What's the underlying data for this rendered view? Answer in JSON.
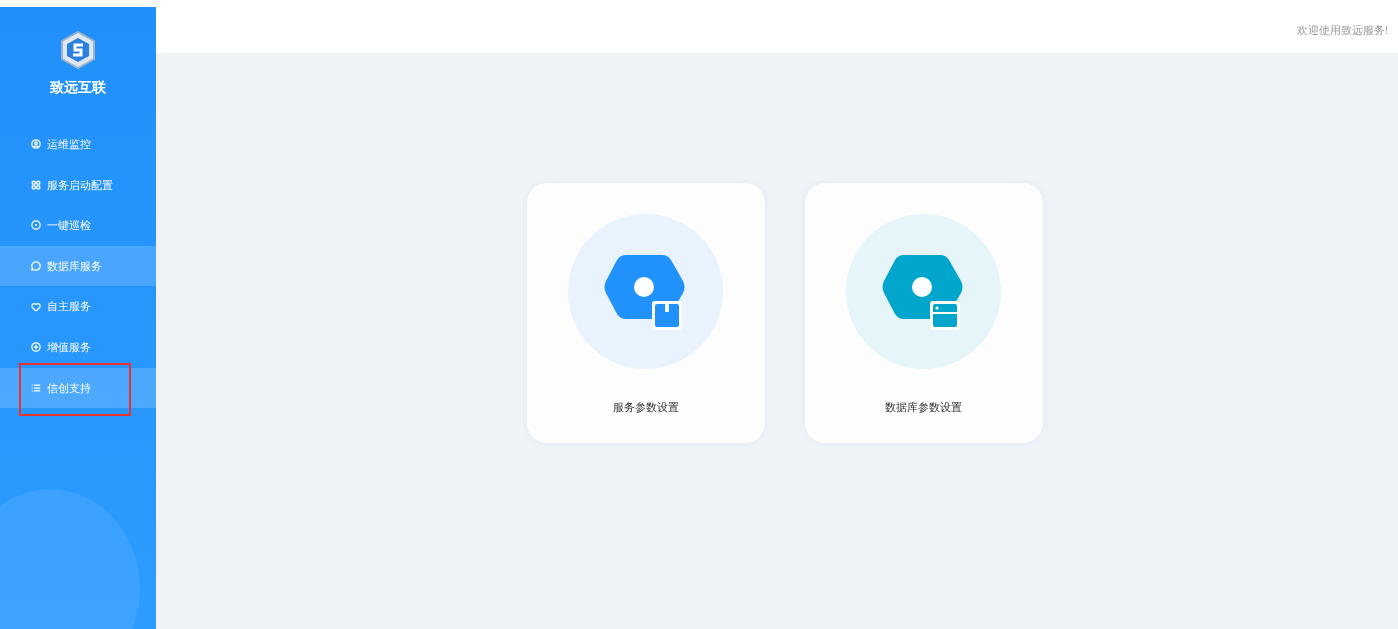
{
  "brand": {
    "name": "致远互联"
  },
  "sidebar": {
    "items": [
      {
        "label": "运维监控",
        "kind": "monitor",
        "selected": false,
        "annotated": false
      },
      {
        "label": "服务启动配置",
        "kind": "grid",
        "selected": false,
        "annotated": false
      },
      {
        "label": "一键巡检",
        "kind": "target",
        "selected": false,
        "annotated": false
      },
      {
        "label": "数据库服务",
        "kind": "chat",
        "selected": true,
        "annotated": false
      },
      {
        "label": "自主服务",
        "kind": "heart",
        "selected": false,
        "annotated": false
      },
      {
        "label": "增值服务",
        "kind": "star",
        "selected": false,
        "annotated": false
      },
      {
        "label": "信创支持",
        "kind": "list",
        "selected": true,
        "annotated": true
      }
    ]
  },
  "header": {
    "welcome": "欢迎使用致远服务!"
  },
  "cards": [
    {
      "label": "服务参数设置",
      "kind": "service",
      "color": "#2191fb"
    },
    {
      "label": "数据库参数设置",
      "kind": "database",
      "color": "#02a6cd"
    }
  ]
}
